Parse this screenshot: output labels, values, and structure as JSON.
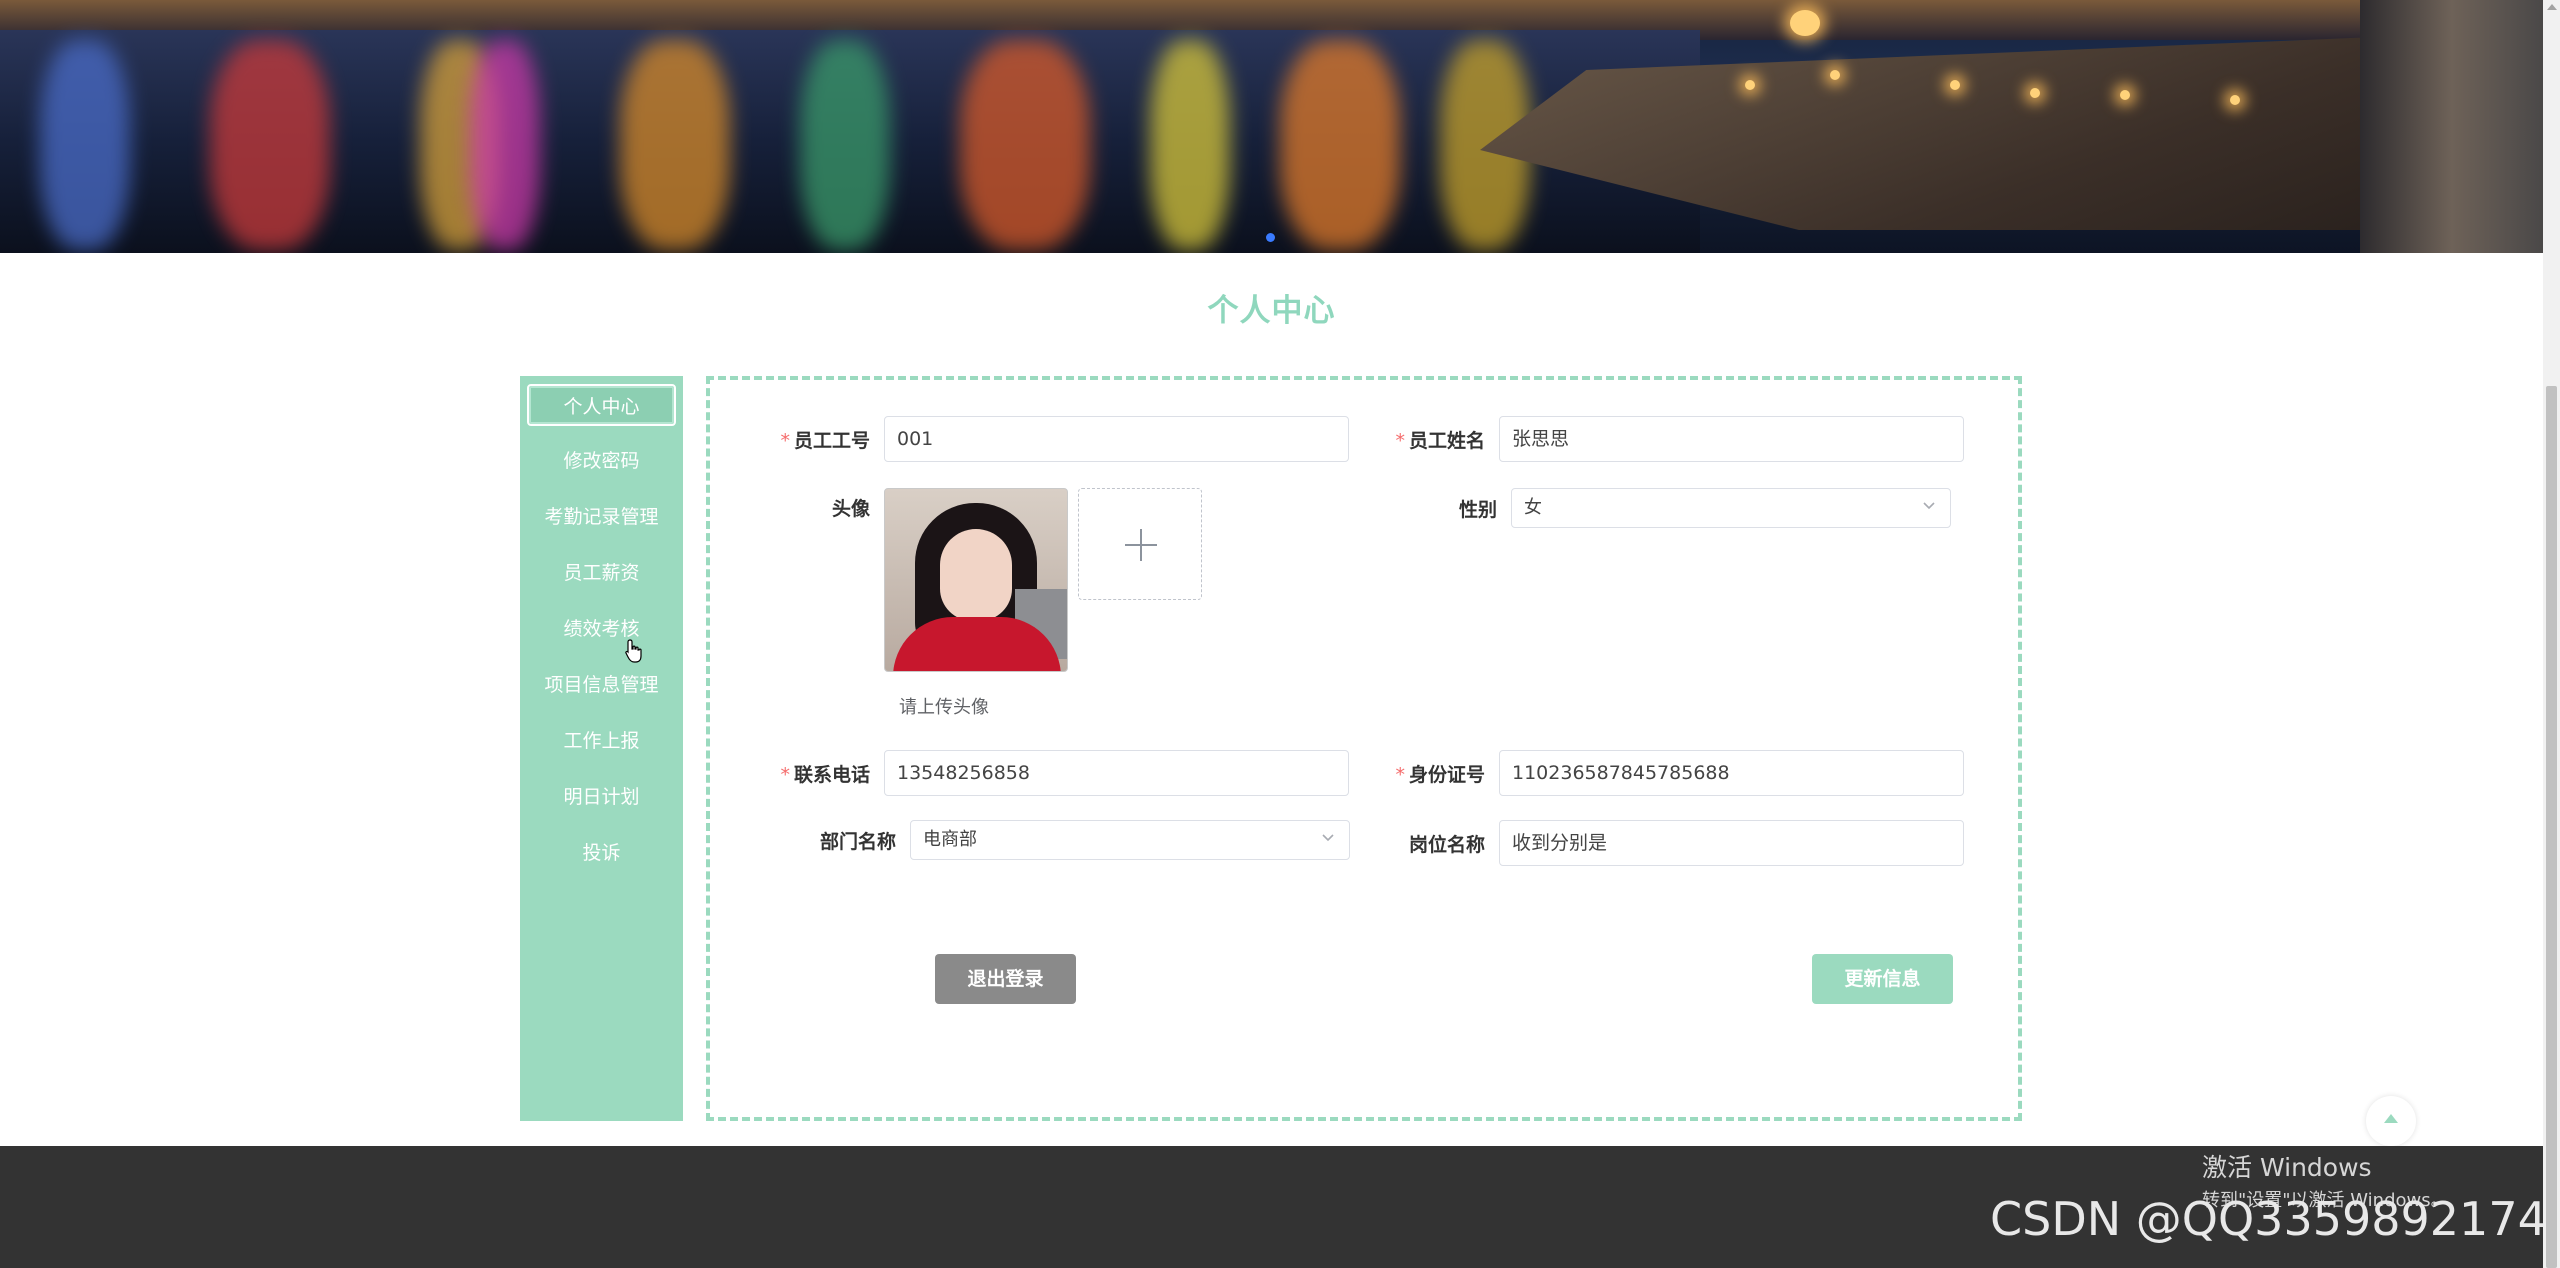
{
  "page": {
    "title": "个人中心"
  },
  "sidebar": {
    "items": [
      {
        "label": "个人中心",
        "active": true
      },
      {
        "label": "修改密码"
      },
      {
        "label": "考勤记录管理"
      },
      {
        "label": "员工薪资"
      },
      {
        "label": "绩效考核"
      },
      {
        "label": "项目信息管理"
      },
      {
        "label": "工作上报"
      },
      {
        "label": "明日计划"
      },
      {
        "label": "投诉"
      }
    ]
  },
  "form": {
    "employee_id": {
      "label": "员工工号",
      "value": "001",
      "required": true
    },
    "employee_name": {
      "label": "员工姓名",
      "value": "张思思",
      "required": true
    },
    "avatar": {
      "label": "头像",
      "tip": "请上传头像"
    },
    "gender": {
      "label": "性别",
      "value": "女"
    },
    "phone": {
      "label": "联系电话",
      "value": "13548256858",
      "required": true
    },
    "id_card": {
      "label": "身份证号",
      "value": "110236587845785688",
      "required": true
    },
    "department": {
      "label": "部门名称",
      "value": "电商部"
    },
    "position": {
      "label": "岗位名称",
      "value": "收到分别是"
    },
    "required_mark": "*"
  },
  "buttons": {
    "logout": "退出登录",
    "update": "更新信息"
  },
  "footer": {
    "windows_line1": "激活 Windows",
    "windows_line2": "转到\"设置\"以激活 Windows。",
    "csdn_watermark": "CSDN @QQ3359892174"
  },
  "icons": {
    "chevron": "chevron-down-icon",
    "plus": "plus-icon",
    "back_to_top": "arrow-up-icon"
  },
  "colors": {
    "accent": "#9bdabf",
    "title": "#8fd7bd",
    "required": "#f56c6c",
    "logout_button": "#8a8a8a",
    "footer": "#333333"
  }
}
